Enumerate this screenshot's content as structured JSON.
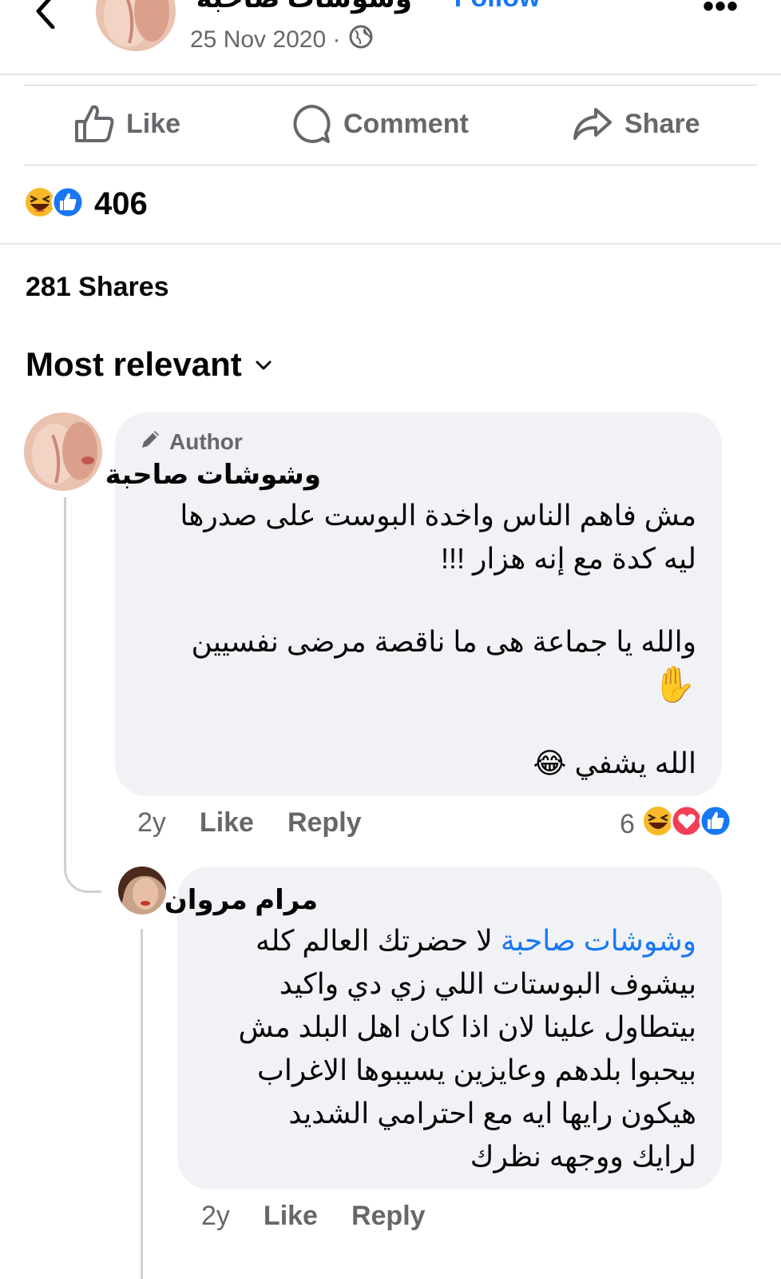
{
  "header": {
    "page_name": "وشوشات صاحبة",
    "follow": "· Follow",
    "date": "25 Nov 2020 ·",
    "more": "•••"
  },
  "actions": {
    "like": "Like",
    "comment": "Comment",
    "share": "Share"
  },
  "reactions": {
    "count": "406",
    "types": [
      "haha",
      "like"
    ]
  },
  "shares": "281 Shares",
  "sort": {
    "label": "Most relevant"
  },
  "comments": [
    {
      "badge": "Author",
      "name": "وشوشات صاحبة",
      "lines": [
        "مش فاهم الناس واخدة البوست على صدرها",
        "ليه كدة مع إنه هزار !!!",
        "والله يا جماعة هى ما ناقصة مرضى نفسيين",
        "✋",
        "الله يشفي 😂"
      ],
      "time": "2y",
      "like": "Like",
      "reply": "Reply",
      "reaction_count": "6",
      "reaction_types": [
        "haha",
        "love",
        "like"
      ]
    },
    {
      "name": "مرام مروان",
      "mention": "وشوشات صاحبة",
      "lines": [
        "لا حضرتك العالم كله",
        "بيشوف البوستات اللي زي دي واكيد",
        "بيتطاول علينا لان اذا كان اهل البلد مش",
        "بيحبوا بلدهم وعايزين يسيبوها الاغراب",
        "هيكون رايها ايه مع احترامي الشديد",
        "لرايك ووجهه نظرك"
      ],
      "time": "2y",
      "like": "Like",
      "reply": "Reply"
    }
  ],
  "colors": {
    "accent": "#1877f2",
    "secondary_text": "#65676b",
    "bubble": "#f0f2f5"
  }
}
